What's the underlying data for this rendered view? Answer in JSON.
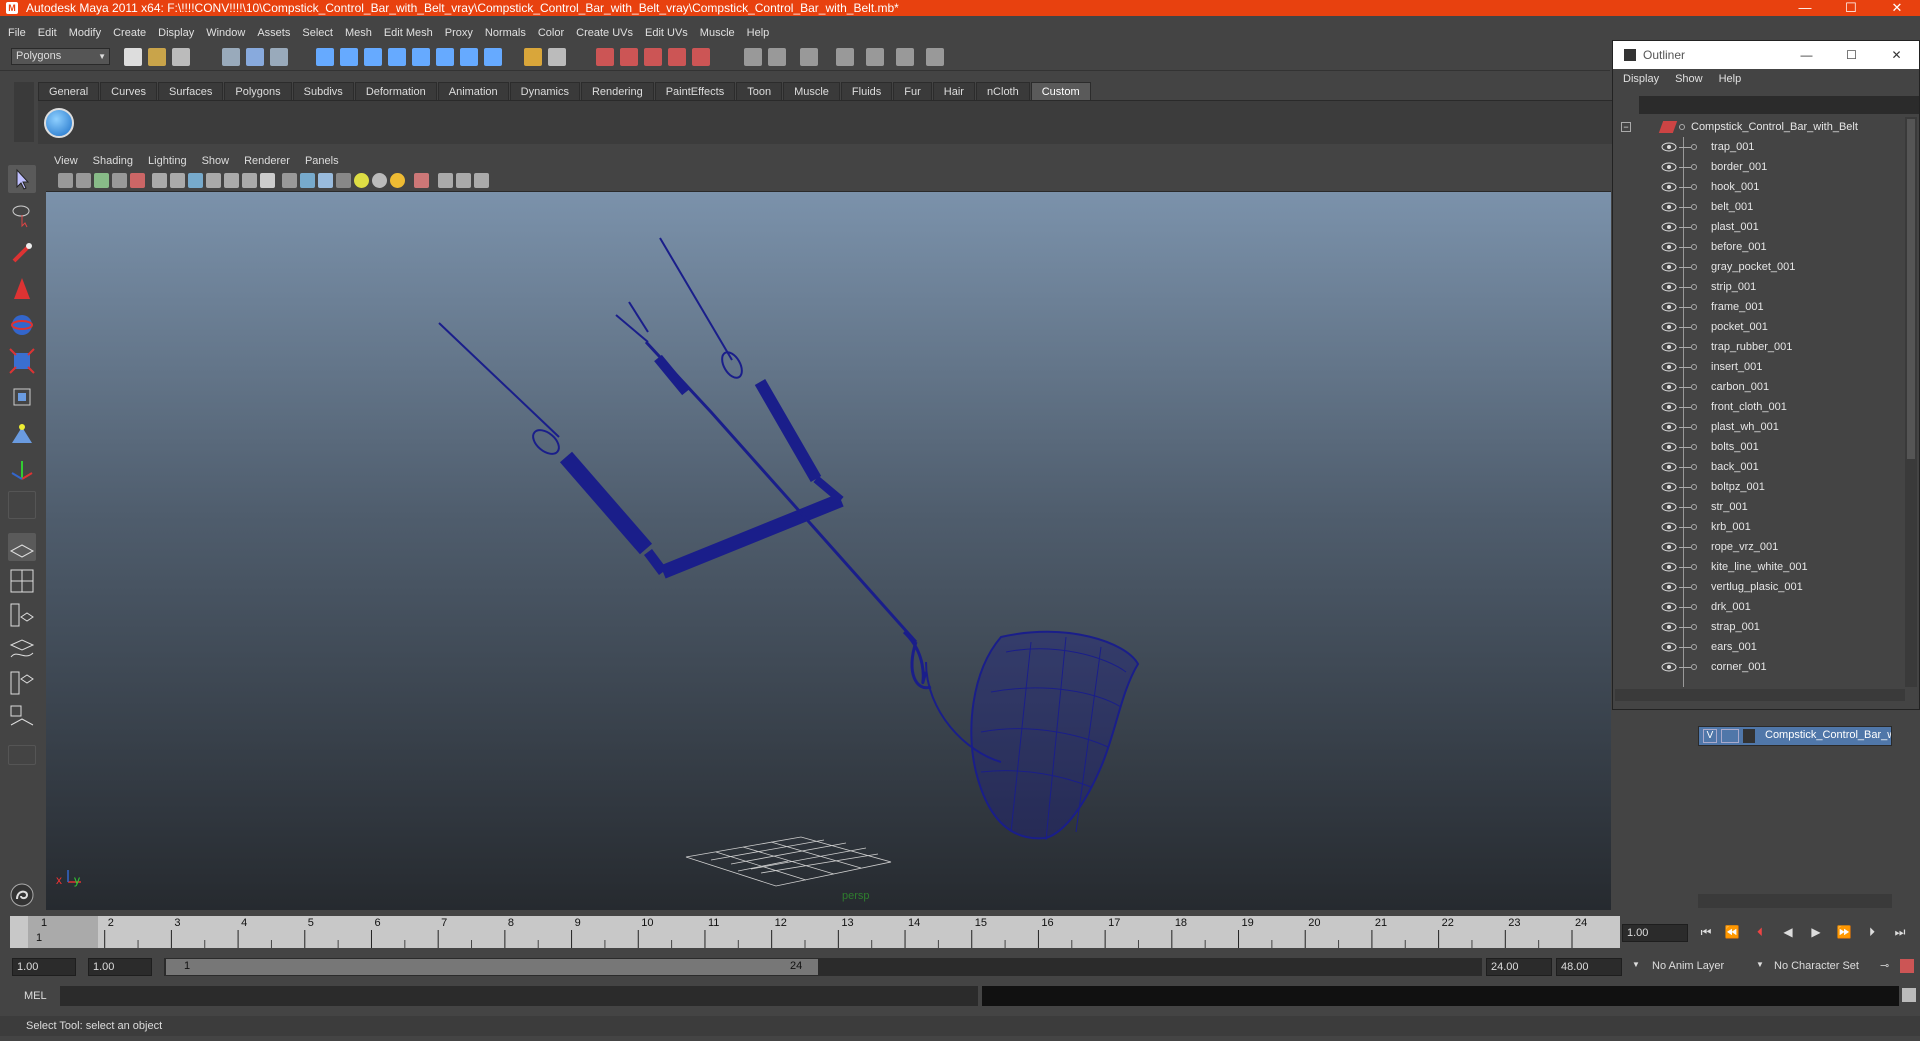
{
  "window": {
    "title": "Autodesk Maya 2011 x64: F:\\!!!!CONV!!!!\\10\\Compstick_Control_Bar_with_Belt_vray\\Compstick_Control_Bar_with_Belt_vray\\Compstick_Control_Bar_with_Belt.mb*",
    "minimize": "—",
    "maximize": "☐",
    "close": "✕"
  },
  "menubar": [
    "File",
    "Edit",
    "Modify",
    "Create",
    "Display",
    "Window",
    "Assets",
    "Select",
    "Mesh",
    "Edit Mesh",
    "Proxy",
    "Normals",
    "Color",
    "Create UVs",
    "Edit UVs",
    "Muscle",
    "Help"
  ],
  "toolbar": {
    "mode": "Polygons"
  },
  "shelf": {
    "tabs": [
      "General",
      "Curves",
      "Surfaces",
      "Polygons",
      "Subdivs",
      "Deformation",
      "Animation",
      "Dynamics",
      "Rendering",
      "PaintEffects",
      "Toon",
      "Muscle",
      "Fluids",
      "Fur",
      "Hair",
      "nCloth",
      "Custom"
    ],
    "active": "Custom"
  },
  "viewport": {
    "menu": [
      "View",
      "Shading",
      "Lighting",
      "Show",
      "Renderer",
      "Panels"
    ],
    "camera_label": "persp",
    "axis_x": "x",
    "axis_y": "y",
    "wire_color": "#1a1e8a"
  },
  "outliner": {
    "title": "Outliner",
    "menu": [
      "Display",
      "Show",
      "Help"
    ],
    "root": "Compstick_Control_Bar_with_Belt",
    "items": [
      "trap_001",
      "border_001",
      "hook_001",
      "belt_001",
      "plast_001",
      "before_001",
      "gray_pocket_001",
      "strip_001",
      "frame_001",
      "pocket_001",
      "trap_rubber_001",
      "insert_001",
      "carbon_001",
      "front_cloth_001",
      "plast_wh_001",
      "bolts_001",
      "back_001",
      "boltpz_001",
      "str_001",
      "krb_001",
      "rope_vrz_001",
      "kite_line_white_001",
      "vertlug_plasic_001",
      "drk_001",
      "strap_001",
      "ears_001",
      "corner_001"
    ]
  },
  "layers": {
    "visible": "V",
    "name": "Compstick_Control_Bar_with_Belt"
  },
  "timeline": {
    "ticks": [
      "1",
      "2",
      "3",
      "4",
      "5",
      "6",
      "7",
      "8",
      "9",
      "10",
      "11",
      "12",
      "13",
      "14",
      "15",
      "16",
      "17",
      "18",
      "19",
      "20",
      "21",
      "22",
      "23",
      "24"
    ],
    "current_frame": "1",
    "current_time": "1.00"
  },
  "range": {
    "start": "1.00",
    "anim_start": "1.00",
    "slider_start": "1",
    "slider_end": "24",
    "end": "24.00",
    "anim_end": "48.00",
    "anim_layer": "No Anim Layer",
    "char_set": "No Character Set"
  },
  "mel": {
    "label": "MEL"
  },
  "help_line": "Select Tool: select an object"
}
